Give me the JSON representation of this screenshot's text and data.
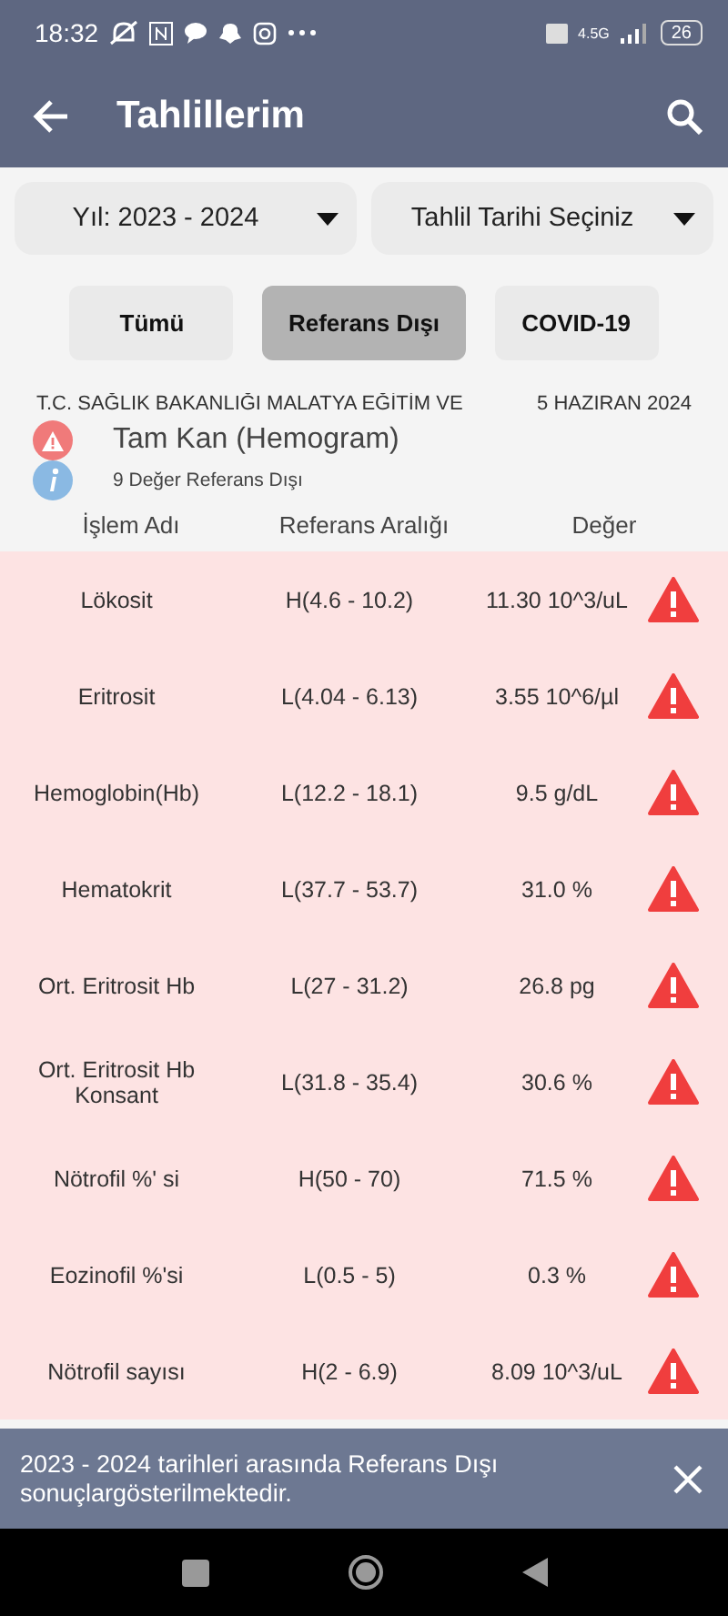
{
  "status_bar": {
    "time": "18:32",
    "network": "4.5G",
    "battery": "26"
  },
  "app_bar": {
    "title": "Tahlillerim"
  },
  "dropdowns": [
    {
      "label": "Yıl: 2023 - 2024"
    },
    {
      "label": "Tahlil Tarihi Seçiniz"
    }
  ],
  "filters": [
    {
      "label": "Tümü",
      "selected": false
    },
    {
      "label": "Referans Dışı",
      "selected": true
    },
    {
      "label": "COVID-19",
      "selected": false
    }
  ],
  "report": {
    "hospital": "T.C. SAĞLIK BAKANLIĞI MALATYA EĞİTİM VE",
    "date": "5 HAZIRAN 2024",
    "title": "Tam Kan (Hemogram)",
    "summary": "9 Değer Referans Dışı"
  },
  "table": {
    "columns": [
      "İşlem Adı",
      "Referans Aralığı",
      "Değer"
    ],
    "rows": [
      {
        "name": "Lökosit",
        "range": "H(4.6 - 10.2)",
        "value": "11.30 10^3/uL",
        "out_of_range": true
      },
      {
        "name": "Eritrosit",
        "range": "L(4.04 - 6.13)",
        "value": "3.55 10^6/µl",
        "out_of_range": true
      },
      {
        "name": "Hemoglobin(Hb)",
        "range": "L(12.2 - 18.1)",
        "value": "9.5 g/dL",
        "out_of_range": true
      },
      {
        "name": "Hematokrit",
        "range": "L(37.7 - 53.7)",
        "value": "31.0 %",
        "out_of_range": true
      },
      {
        "name": "Ort. Eritrosit Hb",
        "range": "L(27 - 31.2)",
        "value": "26.8 pg",
        "out_of_range": true
      },
      {
        "name": "Ort. Eritrosit Hb Konsant",
        "range": "L(31.8 - 35.4)",
        "value": "30.6 %",
        "out_of_range": true
      },
      {
        "name": "Nötrofil %' si",
        "range": "H(50 - 70)",
        "value": "71.5 %",
        "out_of_range": true
      },
      {
        "name": "Eozinofil %'si",
        "range": "L(0.5 - 5)",
        "value": "0.3 %",
        "out_of_range": true
      },
      {
        "name": "Nötrofil sayısı",
        "range": "H(2 - 6.9)",
        "value": "8.09 10^3/uL",
        "out_of_range": true
      }
    ]
  },
  "snackbar": {
    "message": "2023 - 2024 tarihleri arasında Referans Dışı sonuçlargösterilmektedir."
  }
}
